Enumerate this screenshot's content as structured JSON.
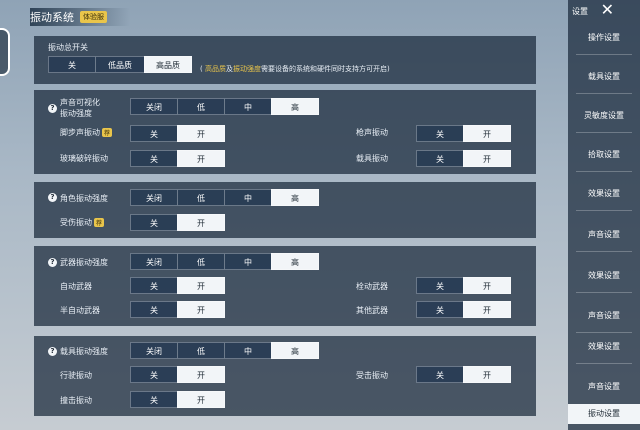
{
  "header": {
    "title": "振动系统",
    "badge": "体验服"
  },
  "top": {
    "label": "振动总开关",
    "options": [
      "关",
      "低品质",
      "高品质"
    ],
    "selected": 2,
    "note_hl1": "高品质",
    "note_mid": "及",
    "note_hl2": "振动强度",
    "note_rest": "需要设备的系统和硬件同时支持方可开启"
  },
  "intensity_options": [
    "关闭",
    "低",
    "中",
    "高"
  ],
  "toggle_options": [
    "关",
    "开"
  ],
  "section1": {
    "title_line1": "声音可视化",
    "title_line2": "振动强度",
    "intensity_selected": 3,
    "rows": [
      {
        "label": "脚步声振动",
        "tag": "荐",
        "value": 1
      },
      {
        "label": "枪声振动",
        "value": 1
      },
      {
        "label": "玻璃破碎振动",
        "value": 1
      },
      {
        "label": "载具振动",
        "value": 1
      }
    ]
  },
  "section2": {
    "title": "角色振动强度",
    "intensity_selected": 3,
    "rows": [
      {
        "label": "受伤振动",
        "tag": "荐",
        "value": 1
      }
    ]
  },
  "section3": {
    "title": "武器振动强度",
    "intensity_selected": 3,
    "rows": [
      {
        "label": "自动武器",
        "value": 1
      },
      {
        "label": "栓动武器",
        "value": 1
      },
      {
        "label": "半自动武器",
        "value": 1
      },
      {
        "label": "其他武器",
        "value": 1
      }
    ]
  },
  "section4": {
    "title": "载具振动强度",
    "intensity_selected": 3,
    "rows": [
      {
        "label": "行驶振动",
        "value": 1
      },
      {
        "label": "受击振动",
        "value": 1
      },
      {
        "label": "撞击振动",
        "value": 1
      }
    ]
  },
  "sidebar": {
    "title": "设置",
    "items": [
      "操作设置",
      "载具设置",
      "灵敏度设置",
      "拾取设置",
      "效果设置",
      "声音设置",
      "效果设置",
      "声音设置",
      "效果设置",
      "声音设置",
      "振动设置"
    ],
    "active_index": 10
  },
  "colors": {
    "accent": "#e9c54b",
    "panel": "#19283a",
    "selected": "#f2f5f8"
  }
}
